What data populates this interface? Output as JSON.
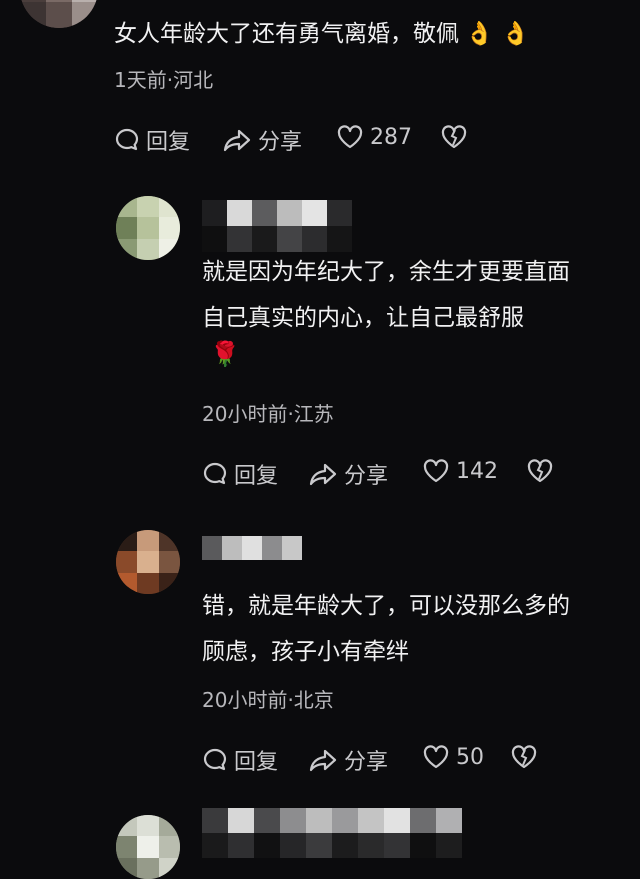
{
  "comments": [
    {
      "text": "女人年龄大了还有勇气离婚，敬佩",
      "emoji": "👌 👌",
      "meta": "1天前·河北",
      "reply_label": "回复",
      "share_label": "分享",
      "likes": "287"
    },
    {
      "lines": [
        "就是因为年纪大了，余生才更要直面",
        "自己真实的内心，让自己最舒服"
      ],
      "emoji": "🌹",
      "meta": "20小时前·江苏",
      "reply_label": "回复",
      "share_label": "分享",
      "likes": "142"
    },
    {
      "lines": [
        "错，就是年龄大了，可以没那么多的",
        "顾虑，孩子小有牵绊"
      ],
      "meta": "20小时前·北京",
      "reply_label": "回复",
      "share_label": "分享",
      "likes": "50"
    }
  ],
  "colors": {
    "background": "#0b0b0d",
    "meta": "#b7b7bb",
    "action": "#c9c9cc"
  },
  "icons": [
    "reply-bubble-icon",
    "share-arrow-icon",
    "heart-icon",
    "dislike-heart-icon"
  ]
}
